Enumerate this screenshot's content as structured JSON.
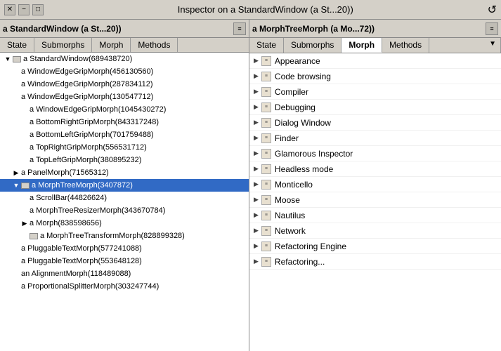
{
  "titleBar": {
    "title": "Inspector on a StandardWindow (a St...20))",
    "closeLabel": "✕",
    "minimizeLabel": "−",
    "maximizeLabel": "□",
    "refreshLabel": "↺"
  },
  "leftPanel": {
    "headerTitle": "a StandardWindow (a St...20))",
    "headerIcon": "≡",
    "tabs": [
      {
        "label": "State",
        "active": false
      },
      {
        "label": "Submorphs",
        "active": false
      },
      {
        "label": "Morph",
        "active": false
      },
      {
        "label": "Methods",
        "active": false
      }
    ],
    "treeItems": [
      {
        "indent": 0,
        "arrow": "▼",
        "icon": true,
        "label": "a StandardWindow(689438720)",
        "selected": false,
        "level": 0
      },
      {
        "indent": 1,
        "arrow": "",
        "icon": false,
        "label": "a WindowEdgeGripMorph(456130560)",
        "selected": false,
        "level": 1
      },
      {
        "indent": 1,
        "arrow": "",
        "icon": false,
        "label": "a WindowEdgeGripMorph(287834112)",
        "selected": false,
        "level": 1
      },
      {
        "indent": 1,
        "arrow": "",
        "icon": false,
        "label": "a WindowEdgeGripMorph(130547712)",
        "selected": false,
        "level": 1
      },
      {
        "indent": 2,
        "arrow": "",
        "icon": false,
        "label": "a WindowEdgeGripMorph(1045430272)",
        "selected": false,
        "level": 2
      },
      {
        "indent": 2,
        "arrow": "",
        "icon": false,
        "label": "a BottomRightGripMorph(843317248)",
        "selected": false,
        "level": 2
      },
      {
        "indent": 2,
        "arrow": "",
        "icon": false,
        "label": "a BottomLeftGripMorph(701759488)",
        "selected": false,
        "level": 2
      },
      {
        "indent": 2,
        "arrow": "",
        "icon": false,
        "label": "a TopRightGripMorph(556531712)",
        "selected": false,
        "level": 2
      },
      {
        "indent": 2,
        "arrow": "",
        "icon": false,
        "label": "a TopLeftGripMorph(380895232)",
        "selected": false,
        "level": 2
      },
      {
        "indent": 1,
        "arrow": "▶",
        "icon": false,
        "label": "a PanelMorph(71565312)",
        "selected": false,
        "level": 1
      },
      {
        "indent": 1,
        "arrow": "▼",
        "icon": true,
        "label": "a MorphTreeMorph(3407872)",
        "selected": true,
        "level": 1
      },
      {
        "indent": 2,
        "arrow": "",
        "icon": false,
        "label": "a ScrollBar(44826624)",
        "selected": false,
        "level": 2
      },
      {
        "indent": 2,
        "arrow": "",
        "icon": false,
        "label": "a MorphTreeResizerMorph(343670784)",
        "selected": false,
        "level": 2
      },
      {
        "indent": 2,
        "arrow": "▶",
        "icon": false,
        "label": "a Morph(838598656)",
        "selected": false,
        "level": 2
      },
      {
        "indent": 2,
        "arrow": "",
        "icon": true,
        "label": "a MorphTreeTransformMorph(828899328)",
        "selected": false,
        "level": 2
      },
      {
        "indent": 1,
        "arrow": "",
        "icon": false,
        "label": "a PluggableTextMorph(577241088)",
        "selected": false,
        "level": 1
      },
      {
        "indent": 1,
        "arrow": "",
        "icon": false,
        "label": "a PluggableTextMorph(553648128)",
        "selected": false,
        "level": 1
      },
      {
        "indent": 1,
        "arrow": "",
        "icon": false,
        "label": "an AlignmentMorph(118489088)",
        "selected": false,
        "level": 1
      },
      {
        "indent": 1,
        "arrow": "",
        "icon": false,
        "label": "a ProportionalSplitterMorph(303247744)",
        "selected": false,
        "level": 1
      }
    ]
  },
  "rightPanel": {
    "headerTitle": "a MorphTreeMorph (a Mo...72))",
    "headerIcon": "≡",
    "dropdownIcon": "▼",
    "tabs": [
      {
        "label": "State",
        "active": false
      },
      {
        "label": "Submorphs",
        "active": false
      },
      {
        "label": "Morph",
        "active": true
      },
      {
        "label": "Methods",
        "active": false
      }
    ],
    "listItems": [
      {
        "label": "Appearance"
      },
      {
        "label": "Code browsing"
      },
      {
        "label": "Compiler"
      },
      {
        "label": "Debugging"
      },
      {
        "label": "Dialog Window"
      },
      {
        "label": "Finder"
      },
      {
        "label": "Glamorous Inspector"
      },
      {
        "label": "Headless mode"
      },
      {
        "label": "Monticello"
      },
      {
        "label": "Moose"
      },
      {
        "label": "Nautilus"
      },
      {
        "label": "Network"
      },
      {
        "label": "Refactoring Engine"
      },
      {
        "label": "Refactoring..."
      }
    ]
  }
}
